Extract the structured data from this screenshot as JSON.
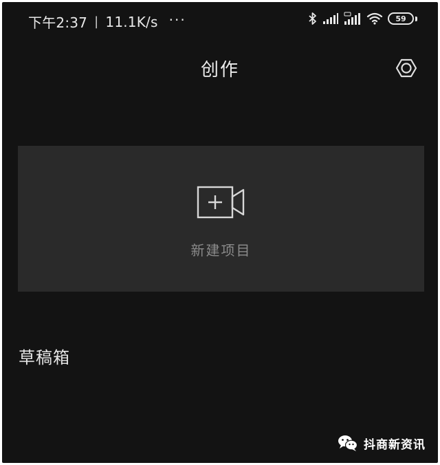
{
  "status_bar": {
    "time": "下午2:37",
    "separator": "|",
    "network_speed": "11.1K/s",
    "more": "···",
    "battery_level": "59",
    "icons": [
      "bluetooth-icon",
      "signal-icon",
      "hd-signal-icon",
      "wifi-icon",
      "battery-icon"
    ]
  },
  "header": {
    "title": "创作",
    "settings_icon": "settings-icon"
  },
  "new_project": {
    "label": "新建项目",
    "icon": "camera-add-icon"
  },
  "drafts": {
    "title": "草稿箱"
  },
  "watermark": {
    "text": "抖商新资讯",
    "icon": "wechat-icon"
  },
  "colors": {
    "background": "#131313",
    "card": "#2a2a2a",
    "text_primary": "#ececec",
    "text_secondary": "#8a8a8a"
  }
}
